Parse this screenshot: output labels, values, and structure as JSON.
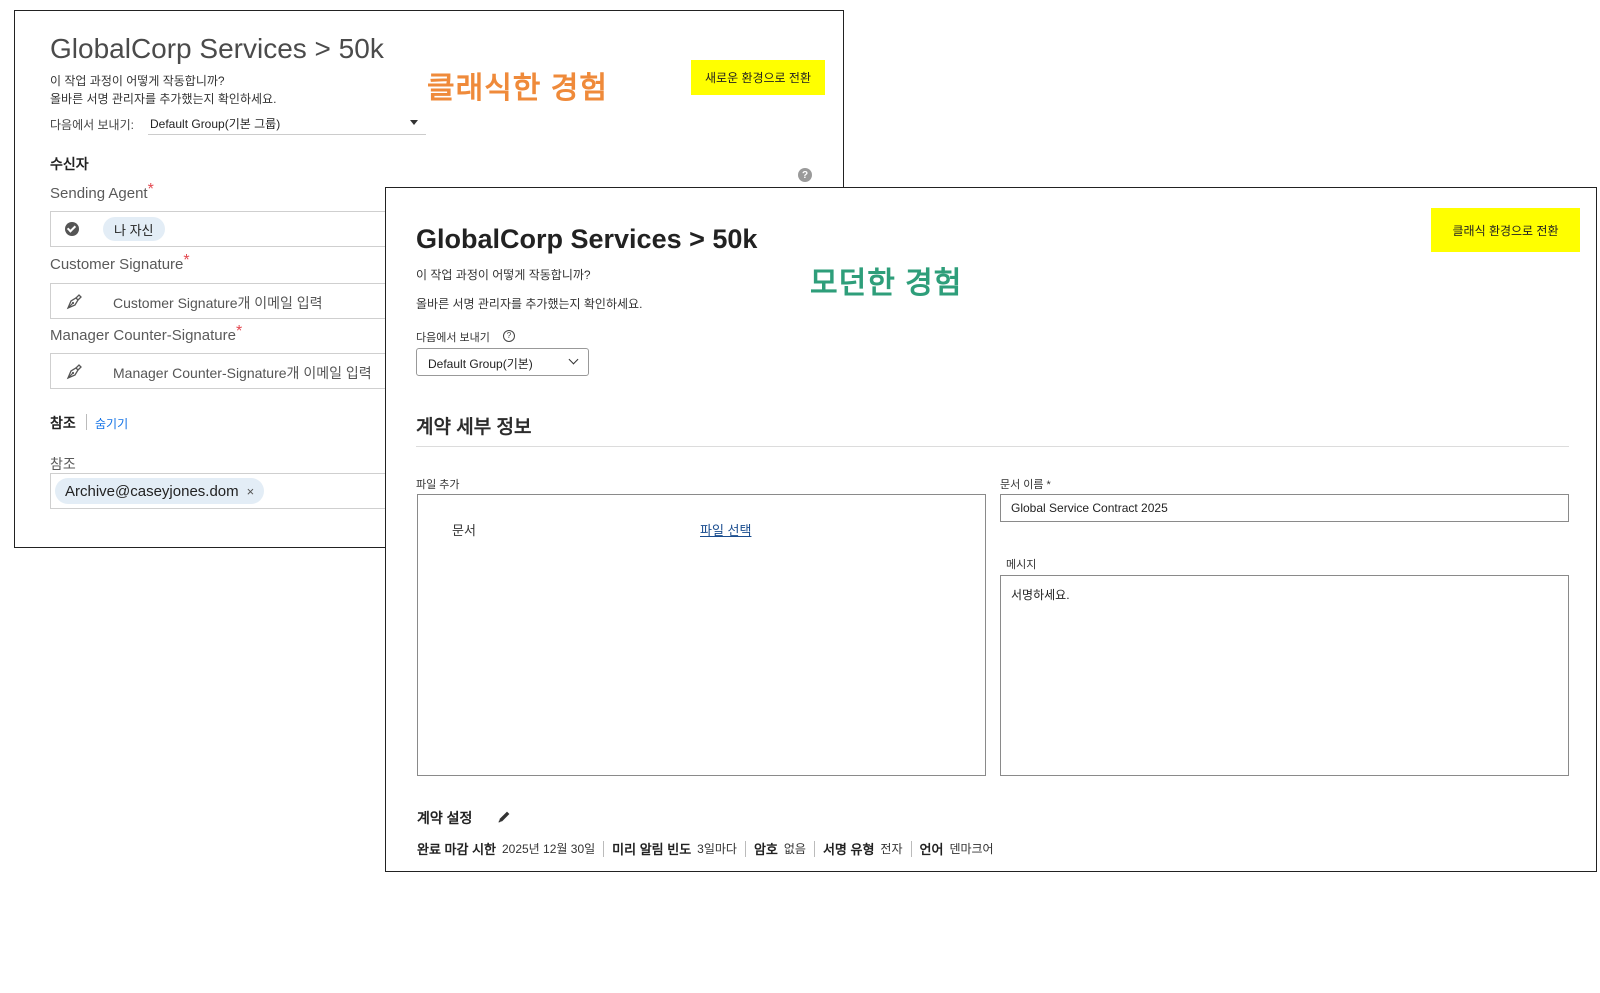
{
  "classic": {
    "title": "GlobalCorp Services > 50k",
    "how_it_works": "이 작업 과정이 어떻게 작동합니까?",
    "check_signers": "올바른 서명 관리자를 추가했는지 확인하세요.",
    "experience_label": "클래식한 경험",
    "switch_button": "새로운 환경으로 전환",
    "send_from_label": "다음에서 보내기:",
    "send_from_value": "Default Group(기본 그룹)",
    "recipients_title": "수신자",
    "help_glyph": "?",
    "fields": [
      {
        "label": "Sending Agent",
        "required": "*",
        "chip": "나 자신"
      },
      {
        "label": "Customer Signature",
        "required": "*",
        "placeholder": "Customer Signature개 이메일 입력"
      },
      {
        "label": "Manager Counter-Signature",
        "required": "*",
        "placeholder": "Manager Counter-Signature개 이메일 입력"
      }
    ],
    "cc_title": "참조",
    "hide_link": "숨기기",
    "cc_label": "참조",
    "cc_chip": "Archive@caseyjones.dom",
    "cc_remove": "×"
  },
  "modern": {
    "title": "GlobalCorp Services > 50k",
    "how_it_works": "이 작업 과정이 어떻게 작동합니까?",
    "check_signers": "올바른 서명 관리자를 추가했는지 확인하세요.",
    "experience_label": "모던한 경험",
    "switch_button": "클래식 환경으로 전환",
    "send_from_label": "다음에서 보내기",
    "help_glyph": "?",
    "send_from_value": "Default Group(기본)",
    "contract_details_title": "계약 세부 정보",
    "add_file_label": "파일 추가",
    "doc_label": "문서",
    "choose_file_link": "파일 선택",
    "doc_name_label": "문서 이름",
    "doc_name_required": "*",
    "doc_name_value": "Global Service Contract 2025",
    "message_label": "메시지",
    "message_value": "서명하세요.",
    "settings_title": "계약 설정",
    "settings": [
      {
        "key": "완료 마감 시한",
        "value": "2025년 12월 30일"
      },
      {
        "key": "미리 알림 빈도",
        "value": "3일마다"
      },
      {
        "key": "암호",
        "value": "없음"
      },
      {
        "key": "서명 유형",
        "value": "전자"
      },
      {
        "key": "언어",
        "value": "덴마크어"
      }
    ]
  },
  "colors": {
    "classic_label": "#ef8a3a",
    "modern_label": "#2e9e7a",
    "switch_button_bg": "#ffff00",
    "required_mark": "#e34850",
    "link": "#1473e6"
  }
}
